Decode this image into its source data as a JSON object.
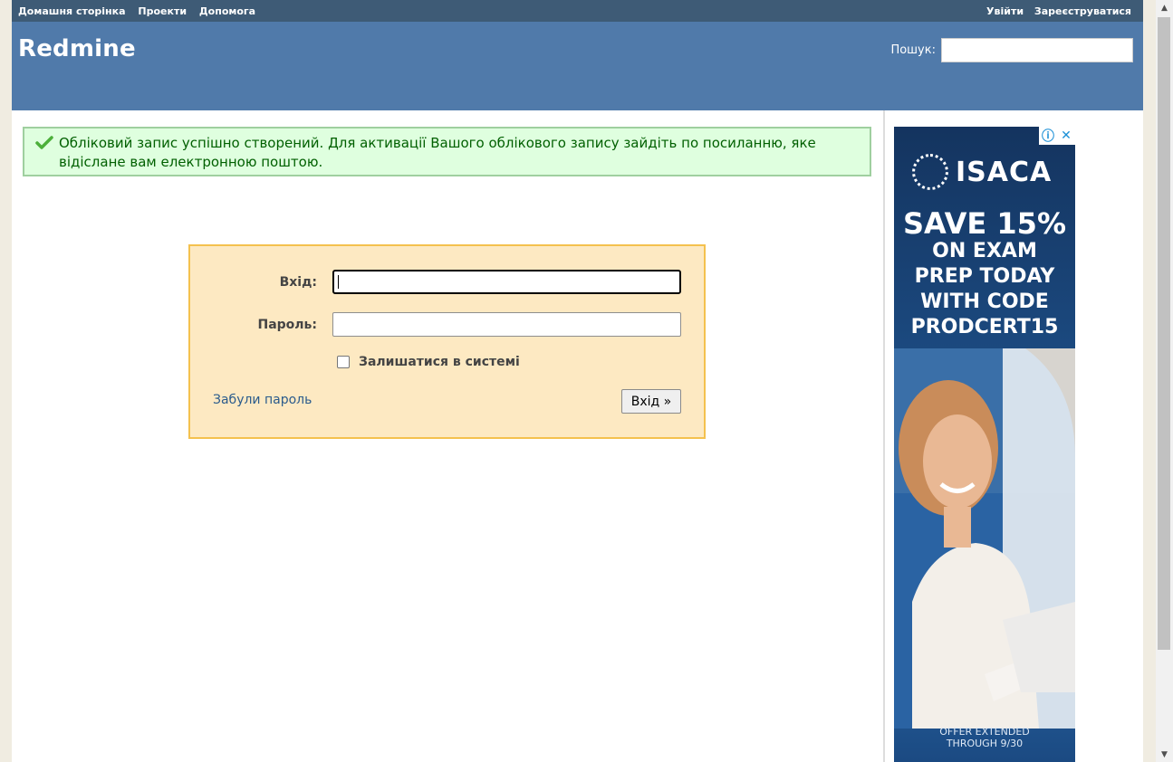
{
  "top_menu": {
    "left": [
      "Домашня сторінка",
      "Проекти",
      "Допомога"
    ],
    "right": [
      "Увійти",
      "Зареєструватися"
    ]
  },
  "header": {
    "title": "Redmine",
    "search_label": "Пошук:",
    "search_value": ""
  },
  "flash": {
    "type": "notice",
    "message": "Обліковий запис успішно створений. Для активації Вашого облікового запису зайдіть по посиланню, яке відіслане вам електронною поштою."
  },
  "login": {
    "username_label": "Вхід:",
    "username_value": "",
    "password_label": "Пароль:",
    "password_value": "",
    "remember_label": "Залишатися в системі",
    "remember_checked": false,
    "lost_password": "Забули пароль",
    "submit_label": "Вхід »"
  },
  "ad": {
    "brand": "ISACA",
    "headline_big": "SAVE 15%",
    "headline_lines": [
      "ON EXAM",
      "PREP TODAY",
      "WITH CODE",
      "PRODCERT15"
    ],
    "footer_lines": [
      "OFFER EXTENDED",
      "THROUGH 9/30"
    ],
    "controls": [
      "info-icon",
      "close-icon"
    ]
  },
  "colors": {
    "top_menu_bg": "#3e5b76",
    "header_bg": "#507aaa",
    "flash_bg": "#dfffdf",
    "flash_border": "#9fcf9f",
    "login_bg": "#fde9c2",
    "login_border": "#f4c14e"
  }
}
